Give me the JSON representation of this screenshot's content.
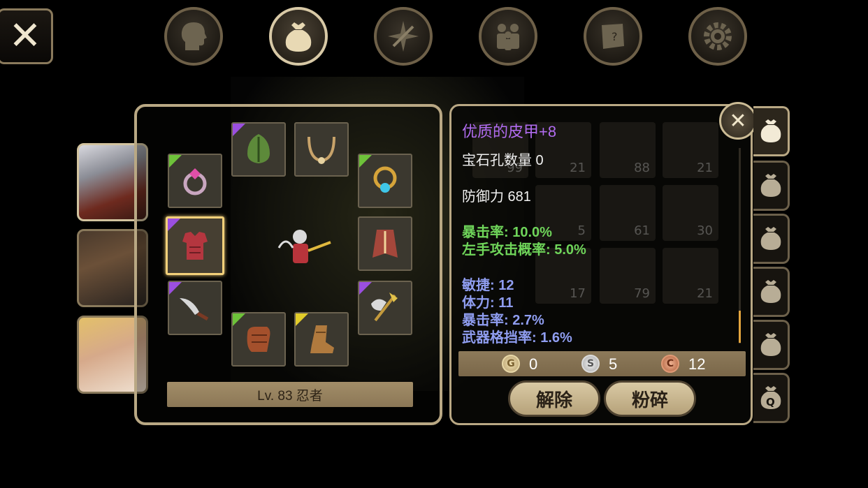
{
  "close_main": {
    "glyph": "✕",
    "icon": "close-icon"
  },
  "nav": [
    {
      "name": "character",
      "icon": "head-profile-icon",
      "active": false
    },
    {
      "name": "inventory",
      "icon": "bag-icon",
      "active": true
    },
    {
      "name": "skills",
      "icon": "compass-sword-icon",
      "active": false
    },
    {
      "name": "party",
      "icon": "people-icon",
      "active": false
    },
    {
      "name": "quests",
      "icon": "scroll-question-icon",
      "active": false
    },
    {
      "name": "settings",
      "icon": "gear-icon",
      "active": false
    }
  ],
  "equipment": {
    "level_label": "Lv. 83 忍者",
    "slots": [
      {
        "name": "helmet",
        "icon": "helmet-icon",
        "rarity": "purple"
      },
      {
        "name": "necklace",
        "icon": "necklace-icon",
        "rarity": "none"
      },
      {
        "name": "ring-left",
        "icon": "ring-pink-icon",
        "rarity": "green"
      },
      {
        "name": "ring-right",
        "icon": "ring-gold-icon",
        "rarity": "green"
      },
      {
        "name": "armor",
        "icon": "armor-icon",
        "rarity": "purple",
        "selected": true
      },
      {
        "name": "cloak",
        "icon": "cloak-icon",
        "rarity": "none"
      },
      {
        "name": "dagger",
        "icon": "dagger-icon",
        "rarity": "purple"
      },
      {
        "name": "axe",
        "icon": "axe-icon",
        "rarity": "purple"
      },
      {
        "name": "gloves",
        "icon": "gloves-icon",
        "rarity": "green"
      },
      {
        "name": "boots",
        "icon": "boots-icon",
        "rarity": "yellow"
      }
    ]
  },
  "portraits": [
    {
      "name": "white-hair-ninja",
      "active": true
    },
    {
      "name": "brown-hair-warrior",
      "active": false
    },
    {
      "name": "blonde-girl",
      "active": false
    }
  ],
  "detail": {
    "title": "优质的皮甲+8",
    "gem_slots": "宝石孔数量 0",
    "defense": "防御力 681",
    "bonus_green": [
      "暴击率: 10.0%",
      "左手攻击概率: 5.0%"
    ],
    "bonus_blue": [
      "敏捷: 12",
      "体力: 11",
      "暴击率: 2.7%",
      "武器格挡率: 1.6%"
    ],
    "currency": [
      {
        "letter": "G",
        "value": "0"
      },
      {
        "letter": "S",
        "value": "5"
      },
      {
        "letter": "C",
        "value": "12"
      }
    ],
    "buttons": {
      "unequip": "解除",
      "shatter": "粉碎"
    },
    "close_glyph": "✕"
  },
  "bg_inventory_counts": [
    "99",
    "21",
    "88",
    "21",
    "5",
    "61",
    "30",
    "17",
    "79",
    "21"
  ],
  "colors": {
    "rarity_purple": "#9b4fe0",
    "rarity_green": "#6ec23a",
    "rarity_yellow": "#e2cc2a"
  },
  "bag_tabs": [
    {
      "name": "bag-1",
      "active": true
    },
    {
      "name": "bag-2",
      "active": false
    },
    {
      "name": "bag-3",
      "active": false
    },
    {
      "name": "bag-4",
      "active": false
    },
    {
      "name": "bag-5",
      "active": false
    },
    {
      "name": "bag-quest",
      "active": false,
      "label": "Q"
    }
  ]
}
